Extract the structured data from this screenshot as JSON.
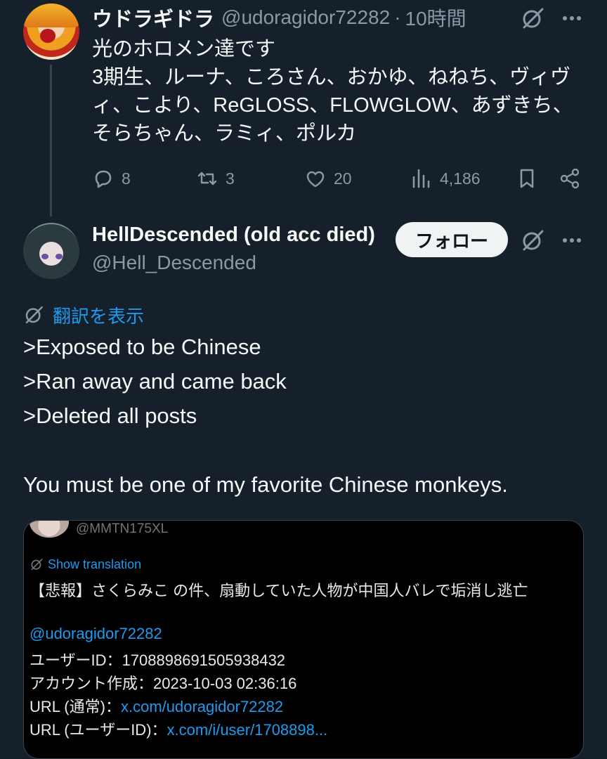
{
  "tweet1": {
    "display_name": "ウドラギドラ",
    "handle": "@udoragidor72282",
    "separator": "·",
    "time": "10時間",
    "text": "光のホロメン達です\n3期生、ルーナ、ころさん、おかゆ、ねねち、ヴィヴィ、こより、ReGLOSS、FLOWGLOW、あずきち、そらちゃん、ラミィ、ポルカ",
    "stats": {
      "replies": "8",
      "retweets": "3",
      "likes": "20",
      "views": "4,186"
    }
  },
  "tweet2": {
    "display_name": "HellDescended (old acc died)",
    "handle": "@Hell_Descended",
    "follow_label": "フォロー",
    "translate_label": "翻訳を表示",
    "lines": [
      ">Exposed to be Chinese",
      ">Ran away and came back",
      ">Deleted all posts",
      "You must be one of my favorite Chinese monkeys."
    ]
  },
  "embedded": {
    "handle": "@MMTN175XL",
    "translate_label": "Show translation",
    "headline": "【悲報】さくらみこ の件、扇動していた人物が中国人バレで垢消し逃亡",
    "mention": "@udoragidor72282",
    "userid_label": "ユーザーID：",
    "userid_value": "1708898691505938432",
    "created_label": "アカウント作成：",
    "created_value": "2023-10-03 02:36:16",
    "url_normal_label": "URL (通常)：",
    "url_normal_value": "x.com/udoragidor72282",
    "url_id_label": "URL (ユーザーID)：",
    "url_id_value": "x.com/i/user/1708898..."
  },
  "colors": {
    "background": "#15202b",
    "text": "#f7f9f9",
    "muted": "#8b98a5",
    "link": "#1d9bf0",
    "follow_button_bg": "#eff3f4"
  },
  "icons": [
    "grok-icon",
    "more-icon",
    "reply-icon",
    "retweet-icon",
    "like-icon",
    "views-icon",
    "bookmark-icon",
    "share-icon",
    "translate-icon"
  ]
}
